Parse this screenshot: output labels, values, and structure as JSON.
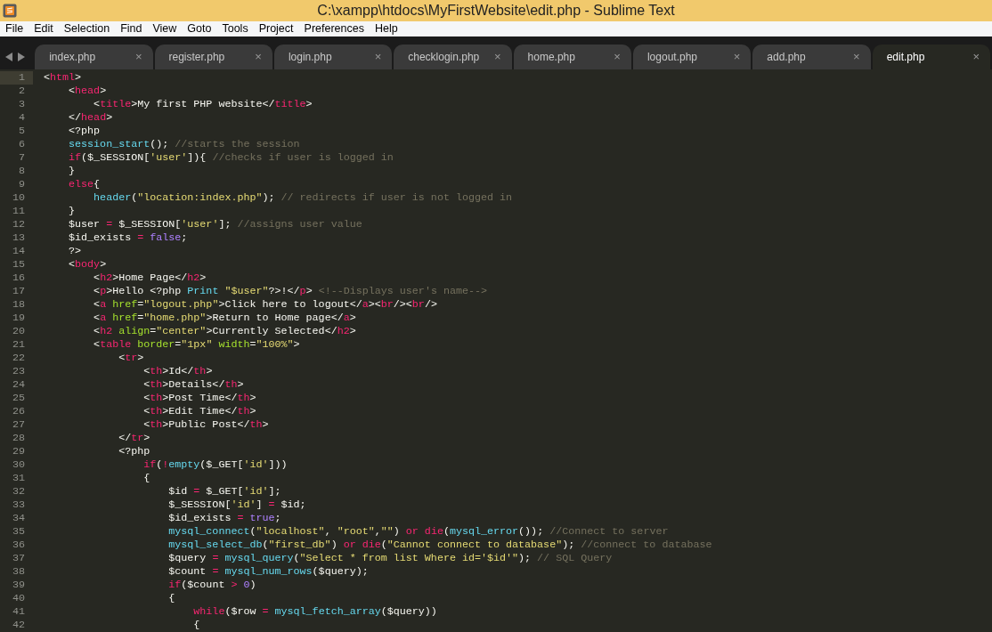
{
  "window": {
    "title": "C:\\xampp\\htdocs\\MyFirstWebsite\\edit.php - Sublime Text"
  },
  "menu": [
    "File",
    "Edit",
    "Selection",
    "Find",
    "View",
    "Goto",
    "Tools",
    "Project",
    "Preferences",
    "Help"
  ],
  "tabs": [
    {
      "label": "index.php",
      "close": "×",
      "selected": false
    },
    {
      "label": "register.php",
      "close": "×",
      "selected": false
    },
    {
      "label": "login.php",
      "close": "×",
      "selected": false
    },
    {
      "label": "checklogin.php",
      "close": "×",
      "selected": false
    },
    {
      "label": "home.php",
      "close": "×",
      "selected": false
    },
    {
      "label": "logout.php",
      "close": "×",
      "selected": false
    },
    {
      "label": "add.php",
      "close": "×",
      "selected": false
    },
    {
      "label": "edit.php",
      "close": "×",
      "selected": true
    }
  ],
  "editor": {
    "lines": [
      {
        "number": "1",
        "selected": true,
        "tokens": [
          {
            "text": "<",
            "kind": "plain"
          },
          {
            "text": "html",
            "kind": "tag"
          },
          {
            "text": ">",
            "kind": "plain"
          }
        ]
      },
      {
        "number": "2",
        "selected": false,
        "tokens": [
          {
            "text": "    <",
            "kind": "plain"
          },
          {
            "text": "head",
            "kind": "tag"
          },
          {
            "text": ">",
            "kind": "plain"
          }
        ]
      },
      {
        "number": "3",
        "selected": false,
        "tokens": [
          {
            "text": "        <",
            "kind": "plain"
          },
          {
            "text": "title",
            "kind": "tag"
          },
          {
            "text": ">My first PHP website</",
            "kind": "plain"
          },
          {
            "text": "title",
            "kind": "tag"
          },
          {
            "text": ">",
            "kind": "plain"
          }
        ]
      },
      {
        "number": "4",
        "selected": false,
        "tokens": [
          {
            "text": "    </",
            "kind": "plain"
          },
          {
            "text": "head",
            "kind": "tag"
          },
          {
            "text": ">",
            "kind": "plain"
          }
        ]
      },
      {
        "number": "5",
        "selected": false,
        "tokens": [
          {
            "text": "    <?php",
            "kind": "plain"
          }
        ]
      },
      {
        "number": "6",
        "selected": false,
        "tokens": [
          {
            "text": "    session_start",
            "kind": "function"
          },
          {
            "text": "(); ",
            "kind": "plain"
          },
          {
            "text": "//starts the session",
            "kind": "comment"
          }
        ]
      },
      {
        "number": "7",
        "selected": false,
        "tokens": [
          {
            "text": "    if",
            "kind": "keyword"
          },
          {
            "text": "($_SESSION[",
            "kind": "plain"
          },
          {
            "text": "'user'",
            "kind": "string"
          },
          {
            "text": "]){ ",
            "kind": "plain"
          },
          {
            "text": "//checks if user is logged in",
            "kind": "comment"
          }
        ]
      },
      {
        "number": "8",
        "selected": false,
        "tokens": [
          {
            "text": "    }",
            "kind": "plain"
          }
        ]
      },
      {
        "number": "9",
        "selected": false,
        "tokens": [
          {
            "text": "    else",
            "kind": "keyword"
          },
          {
            "text": "{",
            "kind": "plain"
          }
        ]
      },
      {
        "number": "10",
        "selected": false,
        "tokens": [
          {
            "text": "        header",
            "kind": "function"
          },
          {
            "text": "(",
            "kind": "plain"
          },
          {
            "text": "\"location:index.php\"",
            "kind": "string"
          },
          {
            "text": "); ",
            "kind": "plain"
          },
          {
            "text": "// redirects if user is not logged in",
            "kind": "comment"
          }
        ]
      },
      {
        "number": "11",
        "selected": false,
        "tokens": [
          {
            "text": "    }",
            "kind": "plain"
          }
        ]
      },
      {
        "number": "12",
        "selected": false,
        "tokens": [
          {
            "text": "    $user ",
            "kind": "plain"
          },
          {
            "text": "=",
            "kind": "keyword"
          },
          {
            "text": " $_SESSION[",
            "kind": "plain"
          },
          {
            "text": "'user'",
            "kind": "string"
          },
          {
            "text": "]; ",
            "kind": "plain"
          },
          {
            "text": "//assigns user value",
            "kind": "comment"
          }
        ]
      },
      {
        "number": "13",
        "selected": false,
        "tokens": [
          {
            "text": "    $id_exists ",
            "kind": "plain"
          },
          {
            "text": "= ",
            "kind": "keyword"
          },
          {
            "text": "false",
            "kind": "constant"
          },
          {
            "text": ";",
            "kind": "plain"
          }
        ]
      },
      {
        "number": "14",
        "selected": false,
        "tokens": [
          {
            "text": "    ?>",
            "kind": "plain"
          }
        ]
      },
      {
        "number": "15",
        "selected": false,
        "tokens": [
          {
            "text": "    <",
            "kind": "plain"
          },
          {
            "text": "body",
            "kind": "tag"
          },
          {
            "text": ">",
            "kind": "plain"
          }
        ]
      },
      {
        "number": "16",
        "selected": false,
        "tokens": [
          {
            "text": "        <",
            "kind": "plain"
          },
          {
            "text": "h2",
            "kind": "tag"
          },
          {
            "text": ">Home Page</",
            "kind": "plain"
          },
          {
            "text": "h2",
            "kind": "tag"
          },
          {
            "text": ">",
            "kind": "plain"
          }
        ]
      },
      {
        "number": "17",
        "selected": false,
        "tokens": [
          {
            "text": "        <",
            "kind": "plain"
          },
          {
            "text": "p",
            "kind": "tag"
          },
          {
            "text": ">Hello <?php ",
            "kind": "plain"
          },
          {
            "text": "Print ",
            "kind": "function"
          },
          {
            "text": "\"$user\"",
            "kind": "string"
          },
          {
            "text": "?>!</",
            "kind": "plain"
          },
          {
            "text": "p",
            "kind": "tag"
          },
          {
            "text": "> ",
            "kind": "plain"
          },
          {
            "text": "<!--Displays user's name-->",
            "kind": "comment"
          }
        ]
      },
      {
        "number": "18",
        "selected": false,
        "tokens": [
          {
            "text": "        <",
            "kind": "plain"
          },
          {
            "text": "a",
            "kind": "tag"
          },
          {
            "text": " href",
            "kind": "attribute"
          },
          {
            "text": "=",
            "kind": "plain"
          },
          {
            "text": "\"logout.php\"",
            "kind": "string"
          },
          {
            "text": ">Click here to logout</",
            "kind": "plain"
          },
          {
            "text": "a",
            "kind": "tag"
          },
          {
            "text": "><",
            "kind": "plain"
          },
          {
            "text": "br",
            "kind": "tag"
          },
          {
            "text": "/><",
            "kind": "plain"
          },
          {
            "text": "br",
            "kind": "tag"
          },
          {
            "text": "/>",
            "kind": "plain"
          }
        ]
      },
      {
        "number": "19",
        "selected": false,
        "tokens": [
          {
            "text": "        <",
            "kind": "plain"
          },
          {
            "text": "a",
            "kind": "tag"
          },
          {
            "text": " href",
            "kind": "attribute"
          },
          {
            "text": "=",
            "kind": "plain"
          },
          {
            "text": "\"home.php\"",
            "kind": "string"
          },
          {
            "text": ">Return to Home page</",
            "kind": "plain"
          },
          {
            "text": "a",
            "kind": "tag"
          },
          {
            "text": ">",
            "kind": "plain"
          }
        ]
      },
      {
        "number": "20",
        "selected": false,
        "tokens": [
          {
            "text": "        <",
            "kind": "plain"
          },
          {
            "text": "h2",
            "kind": "tag"
          },
          {
            "text": " align",
            "kind": "attribute"
          },
          {
            "text": "=",
            "kind": "plain"
          },
          {
            "text": "\"center\"",
            "kind": "string"
          },
          {
            "text": ">Currently Selected</",
            "kind": "plain"
          },
          {
            "text": "h2",
            "kind": "tag"
          },
          {
            "text": ">",
            "kind": "plain"
          }
        ]
      },
      {
        "number": "21",
        "selected": false,
        "tokens": [
          {
            "text": "        <",
            "kind": "plain"
          },
          {
            "text": "table",
            "kind": "tag"
          },
          {
            "text": " border",
            "kind": "attribute"
          },
          {
            "text": "=",
            "kind": "plain"
          },
          {
            "text": "\"1px\"",
            "kind": "string"
          },
          {
            "text": " width",
            "kind": "attribute"
          },
          {
            "text": "=",
            "kind": "plain"
          },
          {
            "text": "\"100%\"",
            "kind": "string"
          },
          {
            "text": ">",
            "kind": "plain"
          }
        ]
      },
      {
        "number": "22",
        "selected": false,
        "tokens": [
          {
            "text": "            <",
            "kind": "plain"
          },
          {
            "text": "tr",
            "kind": "tag"
          },
          {
            "text": ">",
            "kind": "plain"
          }
        ]
      },
      {
        "number": "23",
        "selected": false,
        "tokens": [
          {
            "text": "                <",
            "kind": "plain"
          },
          {
            "text": "th",
            "kind": "tag"
          },
          {
            "text": ">Id</",
            "kind": "plain"
          },
          {
            "text": "th",
            "kind": "tag"
          },
          {
            "text": ">",
            "kind": "plain"
          }
        ]
      },
      {
        "number": "24",
        "selected": false,
        "tokens": [
          {
            "text": "                <",
            "kind": "plain"
          },
          {
            "text": "th",
            "kind": "tag"
          },
          {
            "text": ">Details</",
            "kind": "plain"
          },
          {
            "text": "th",
            "kind": "tag"
          },
          {
            "text": ">",
            "kind": "plain"
          }
        ]
      },
      {
        "number": "25",
        "selected": false,
        "tokens": [
          {
            "text": "                <",
            "kind": "plain"
          },
          {
            "text": "th",
            "kind": "tag"
          },
          {
            "text": ">Post Time</",
            "kind": "plain"
          },
          {
            "text": "th",
            "kind": "tag"
          },
          {
            "text": ">",
            "kind": "plain"
          }
        ]
      },
      {
        "number": "26",
        "selected": false,
        "tokens": [
          {
            "text": "                <",
            "kind": "plain"
          },
          {
            "text": "th",
            "kind": "tag"
          },
          {
            "text": ">Edit Time</",
            "kind": "plain"
          },
          {
            "text": "th",
            "kind": "tag"
          },
          {
            "text": ">",
            "kind": "plain"
          }
        ]
      },
      {
        "number": "27",
        "selected": false,
        "tokens": [
          {
            "text": "                <",
            "kind": "plain"
          },
          {
            "text": "th",
            "kind": "tag"
          },
          {
            "text": ">Public Post</",
            "kind": "plain"
          },
          {
            "text": "th",
            "kind": "tag"
          },
          {
            "text": ">",
            "kind": "plain"
          }
        ]
      },
      {
        "number": "28",
        "selected": false,
        "tokens": [
          {
            "text": "            </",
            "kind": "plain"
          },
          {
            "text": "tr",
            "kind": "tag"
          },
          {
            "text": ">",
            "kind": "plain"
          }
        ]
      },
      {
        "number": "29",
        "selected": false,
        "tokens": [
          {
            "text": "            <?php",
            "kind": "plain"
          }
        ]
      },
      {
        "number": "30",
        "selected": false,
        "tokens": [
          {
            "text": "                if",
            "kind": "keyword"
          },
          {
            "text": "(",
            "kind": "plain"
          },
          {
            "text": "!",
            "kind": "keyword"
          },
          {
            "text": "empty",
            "kind": "function"
          },
          {
            "text": "($_GET[",
            "kind": "plain"
          },
          {
            "text": "'id'",
            "kind": "string"
          },
          {
            "text": "]))",
            "kind": "plain"
          }
        ]
      },
      {
        "number": "31",
        "selected": false,
        "tokens": [
          {
            "text": "                {",
            "kind": "plain"
          }
        ]
      },
      {
        "number": "32",
        "selected": false,
        "tokens": [
          {
            "text": "                    $id ",
            "kind": "plain"
          },
          {
            "text": "=",
            "kind": "keyword"
          },
          {
            "text": " $_GET[",
            "kind": "plain"
          },
          {
            "text": "'id'",
            "kind": "string"
          },
          {
            "text": "];",
            "kind": "plain"
          }
        ]
      },
      {
        "number": "33",
        "selected": false,
        "tokens": [
          {
            "text": "                    $_SESSION[",
            "kind": "plain"
          },
          {
            "text": "'id'",
            "kind": "string"
          },
          {
            "text": "] ",
            "kind": "plain"
          },
          {
            "text": "=",
            "kind": "keyword"
          },
          {
            "text": " $id;",
            "kind": "plain"
          }
        ]
      },
      {
        "number": "34",
        "selected": false,
        "tokens": [
          {
            "text": "                    $id_exists ",
            "kind": "plain"
          },
          {
            "text": "= ",
            "kind": "keyword"
          },
          {
            "text": "true",
            "kind": "constant"
          },
          {
            "text": ";",
            "kind": "plain"
          }
        ]
      },
      {
        "number": "35",
        "selected": false,
        "tokens": [
          {
            "text": "                    mysql_connect",
            "kind": "function"
          },
          {
            "text": "(",
            "kind": "plain"
          },
          {
            "text": "\"localhost\"",
            "kind": "string"
          },
          {
            "text": ", ",
            "kind": "plain"
          },
          {
            "text": "\"root\"",
            "kind": "string"
          },
          {
            "text": ",",
            "kind": "plain"
          },
          {
            "text": "\"\"",
            "kind": "string"
          },
          {
            "text": ") ",
            "kind": "plain"
          },
          {
            "text": "or die",
            "kind": "keyword"
          },
          {
            "text": "(",
            "kind": "plain"
          },
          {
            "text": "mysql_error",
            "kind": "function"
          },
          {
            "text": "()); ",
            "kind": "plain"
          },
          {
            "text": "//Connect to server",
            "kind": "comment"
          }
        ]
      },
      {
        "number": "36",
        "selected": false,
        "tokens": [
          {
            "text": "                    mysql_select_db",
            "kind": "function"
          },
          {
            "text": "(",
            "kind": "plain"
          },
          {
            "text": "\"first_db\"",
            "kind": "string"
          },
          {
            "text": ") ",
            "kind": "plain"
          },
          {
            "text": "or die",
            "kind": "keyword"
          },
          {
            "text": "(",
            "kind": "plain"
          },
          {
            "text": "\"Cannot connect to database\"",
            "kind": "string"
          },
          {
            "text": "); ",
            "kind": "plain"
          },
          {
            "text": "//connect to database",
            "kind": "comment"
          }
        ]
      },
      {
        "number": "37",
        "selected": false,
        "tokens": [
          {
            "text": "                    $query ",
            "kind": "plain"
          },
          {
            "text": "= ",
            "kind": "keyword"
          },
          {
            "text": "mysql_query",
            "kind": "function"
          },
          {
            "text": "(",
            "kind": "plain"
          },
          {
            "text": "\"Select * from list Where id='$id'\"",
            "kind": "string"
          },
          {
            "text": "); ",
            "kind": "plain"
          },
          {
            "text": "// SQL Query",
            "kind": "comment"
          }
        ]
      },
      {
        "number": "38",
        "selected": false,
        "tokens": [
          {
            "text": "                    $count ",
            "kind": "plain"
          },
          {
            "text": "= ",
            "kind": "keyword"
          },
          {
            "text": "mysql_num_rows",
            "kind": "function"
          },
          {
            "text": "($query);",
            "kind": "plain"
          }
        ]
      },
      {
        "number": "39",
        "selected": false,
        "tokens": [
          {
            "text": "                    if",
            "kind": "keyword"
          },
          {
            "text": "($count ",
            "kind": "plain"
          },
          {
            "text": "> ",
            "kind": "keyword"
          },
          {
            "text": "0",
            "kind": "constant"
          },
          {
            "text": ")",
            "kind": "plain"
          }
        ]
      },
      {
        "number": "40",
        "selected": false,
        "tokens": [
          {
            "text": "                    {",
            "kind": "plain"
          }
        ]
      },
      {
        "number": "41",
        "selected": false,
        "tokens": [
          {
            "text": "                        while",
            "kind": "keyword"
          },
          {
            "text": "($row ",
            "kind": "plain"
          },
          {
            "text": "= ",
            "kind": "keyword"
          },
          {
            "text": "mysql_fetch_array",
            "kind": "function"
          },
          {
            "text": "($query))",
            "kind": "plain"
          }
        ]
      },
      {
        "number": "42",
        "selected": false,
        "tokens": [
          {
            "text": "                        {",
            "kind": "plain"
          }
        ]
      }
    ]
  }
}
